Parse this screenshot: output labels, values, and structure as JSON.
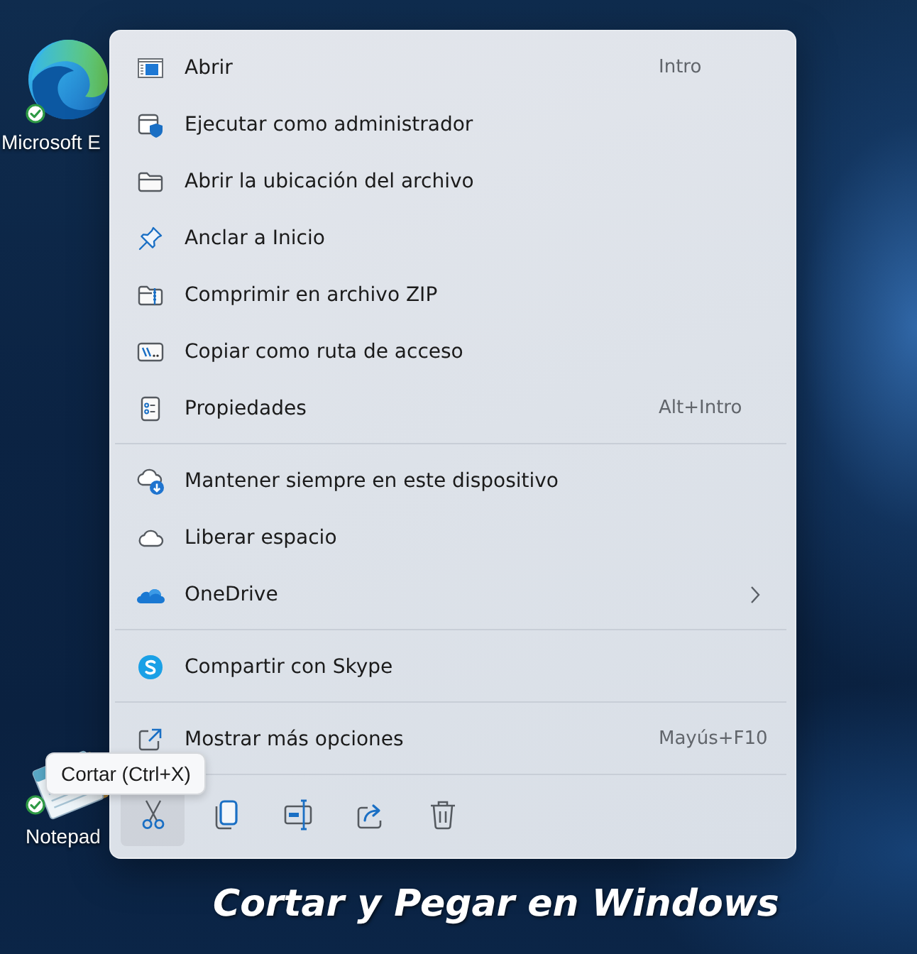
{
  "desktop_icons": [
    {
      "label": "Microsoft E",
      "synced": true
    },
    {
      "label": "Notepad",
      "synced": true
    }
  ],
  "context_menu": {
    "groups": [
      {
        "items": [
          {
            "label": "Abrir",
            "shortcut": "Intro",
            "submenu": false
          },
          {
            "label": "Ejecutar como administrador",
            "submenu": false
          },
          {
            "label": "Abrir la ubicación del archivo",
            "submenu": false
          },
          {
            "label": "Anclar a Inicio",
            "submenu": false
          },
          {
            "label": "Comprimir en archivo ZIP",
            "submenu": false
          },
          {
            "label": "Copiar como ruta de acceso",
            "submenu": false
          },
          {
            "label": "Propiedades",
            "shortcut": "Alt+Intro",
            "submenu": false
          }
        ]
      },
      {
        "items": [
          {
            "label": "Mantener siempre en este dispositivo",
            "submenu": false
          },
          {
            "label": "Liberar espacio",
            "submenu": false
          },
          {
            "label": "OneDrive",
            "submenu": true
          }
        ]
      },
      {
        "items": [
          {
            "label": "Compartir con Skype",
            "submenu": false
          }
        ]
      },
      {
        "items": [
          {
            "label": "Mostrar más opciones",
            "shortcut": "Mayús+F10",
            "submenu": false
          }
        ]
      }
    ],
    "toolbar": [
      {
        "hovered": true
      },
      {
        "hovered": false
      },
      {
        "hovered": false
      },
      {
        "hovered": false
      },
      {
        "hovered": false
      }
    ]
  },
  "tooltip": {
    "text": "Cortar (Ctrl+X)"
  },
  "caption": "Cortar y Pegar en Windows"
}
